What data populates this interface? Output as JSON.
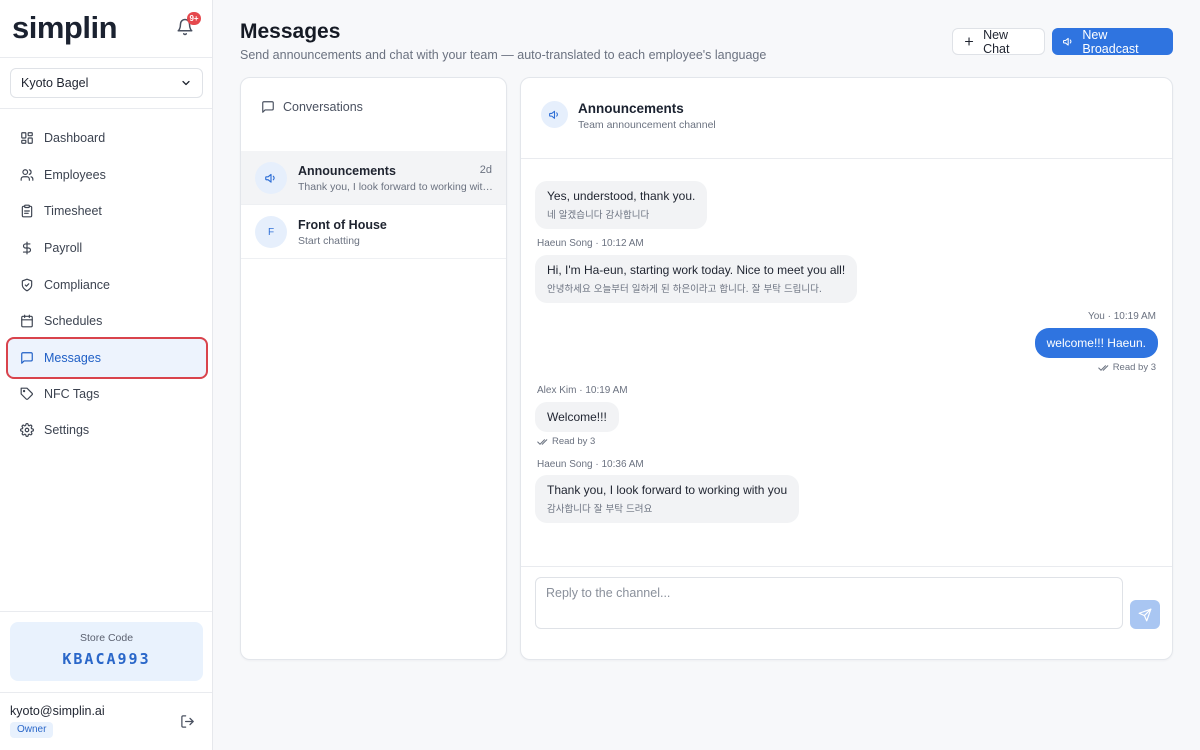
{
  "app": {
    "brand": "simplin",
    "notification_badge": "9+"
  },
  "store_selector": {
    "value": "Kyoto Bagel"
  },
  "sidebar": {
    "items": [
      {
        "label": "Dashboard",
        "icon": "dashboard-icon"
      },
      {
        "label": "Employees",
        "icon": "users-icon"
      },
      {
        "label": "Timesheet",
        "icon": "clipboard-icon"
      },
      {
        "label": "Payroll",
        "icon": "dollar-icon"
      },
      {
        "label": "Compliance",
        "icon": "shield-icon"
      },
      {
        "label": "Schedules",
        "icon": "calendar-icon"
      },
      {
        "label": "Messages",
        "icon": "message-icon",
        "active": true
      },
      {
        "label": "NFC Tags",
        "icon": "tag-icon"
      },
      {
        "label": "Settings",
        "icon": "gear-icon"
      }
    ]
  },
  "store_code": {
    "label": "Store Code",
    "value": "KBACA993"
  },
  "user": {
    "email": "kyoto@simplin.ai",
    "role": "Owner"
  },
  "header": {
    "title": "Messages",
    "subtitle": "Send announcements and chat with your team — auto-translated to each employee's language",
    "new_chat_label": "New Chat",
    "new_broadcast_label": "New Broadcast"
  },
  "conversations": {
    "heading": "Conversations",
    "items": [
      {
        "name": "Announcements",
        "preview": "Thank you, I look forward to working with you",
        "time": "2d",
        "avatar": "megaphone-icon"
      },
      {
        "name": "Front of House",
        "preview": "Start chatting",
        "time": "",
        "avatar_letter": "F"
      }
    ]
  },
  "chat": {
    "title": "Announcements",
    "subtitle": "Team announcement channel",
    "messages": [
      {
        "text": "Yes, understood, thank you.",
        "translation": "네 알겠습니다 감사합니다"
      },
      {
        "meta": "Haeun Song · 10:12 AM",
        "text": "Hi, I'm Ha-eun, starting work today. Nice to meet you all!",
        "translation": "안녕하세요 오늘부터 일하게 된 하은이라고 합니다. 잘 부탁 드립니다."
      },
      {
        "meta": "You · 10:19 AM",
        "text": "welcome!!! Haeun.",
        "read": "Read by 3",
        "mine": true
      },
      {
        "meta": "Alex Kim · 10:19 AM",
        "text": "Welcome!!!",
        "read": "Read by 3"
      },
      {
        "meta": "Haeun Song · 10:36 AM",
        "text": "Thank you, I look forward to working with you",
        "translation": "감사합니다 잘 부탁 드려요"
      }
    ],
    "reply_placeholder": "Reply to the channel..."
  },
  "colors": {
    "accent": "#2f74e0",
    "badge": "#e5484d",
    "active_outline": "#d9434c"
  }
}
